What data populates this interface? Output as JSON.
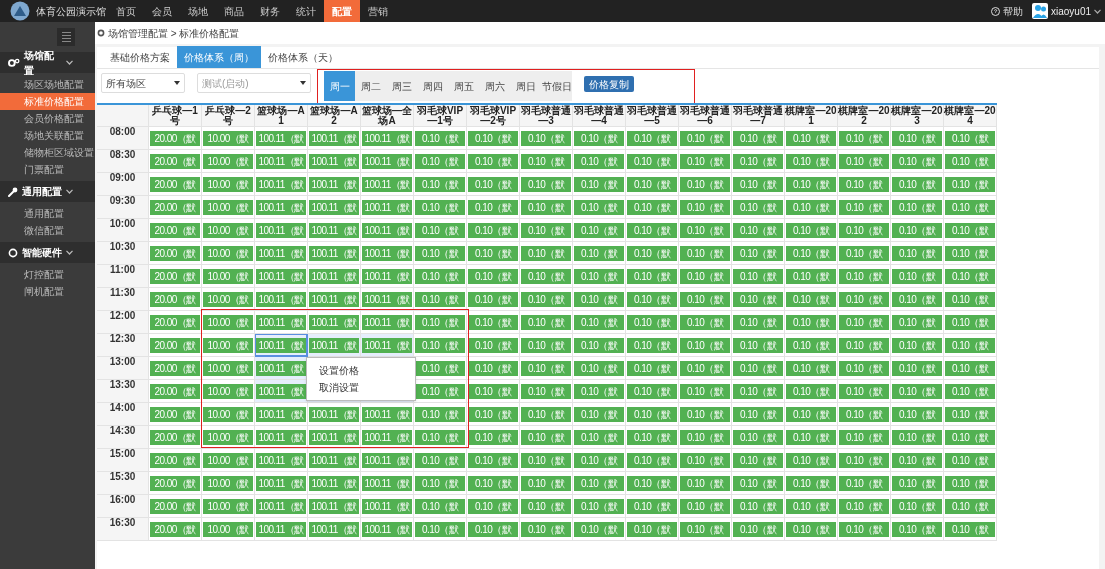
{
  "top_bar": {
    "title": "体育公园演示馆",
    "nav": [
      {
        "label": "首页",
        "selected": false
      },
      {
        "label": "会员",
        "selected": false
      },
      {
        "label": "场地",
        "selected": false
      },
      {
        "label": "商品",
        "selected": false
      },
      {
        "label": "财务",
        "selected": false
      },
      {
        "label": "统计",
        "selected": false
      },
      {
        "label": "配置",
        "selected": true
      },
      {
        "label": "营销",
        "selected": false
      }
    ],
    "help": "帮助",
    "user": "xiaoyu01"
  },
  "sidebar": {
    "groups": [
      {
        "label": "场馆配置",
        "kind": "gear",
        "expanded": true,
        "items": [
          {
            "label": "场区场地配置",
            "selected": false
          },
          {
            "label": "标准价格配置",
            "selected": true
          },
          {
            "label": "会员价格配置",
            "selected": false
          },
          {
            "label": "场地关联配置",
            "selected": false
          },
          {
            "label": "储物柜区域设置",
            "selected": false
          },
          {
            "label": "门票配置",
            "selected": false
          }
        ]
      },
      {
        "label": "通用配置",
        "kind": "wrench",
        "expanded": true,
        "items": [
          {
            "label": "通用配置",
            "selected": false
          },
          {
            "label": "微信配置",
            "selected": false
          }
        ]
      },
      {
        "label": "智能硬件",
        "kind": "ring",
        "expanded": true,
        "items": [
          {
            "label": "灯控配置",
            "selected": false
          },
          {
            "label": "闸机配置",
            "selected": false
          }
        ]
      }
    ]
  },
  "breadcrumb": "场馆管理配置 > 标准价格配置",
  "tabs": [
    {
      "label": "基础价格方案",
      "selected": false
    },
    {
      "label": "价格体系（周）",
      "selected": true
    },
    {
      "label": "价格体系（天）",
      "selected": false
    }
  ],
  "filters": [
    {
      "value": "所有场区",
      "muted": false
    },
    {
      "value": "测试(启动)",
      "muted": true
    }
  ],
  "day_tabs": [
    {
      "label": "周一",
      "selected": true
    },
    {
      "label": "周二",
      "selected": false
    },
    {
      "label": "周三",
      "selected": false
    },
    {
      "label": "周四",
      "selected": false
    },
    {
      "label": "周五",
      "selected": false
    },
    {
      "label": "周六",
      "selected": false
    },
    {
      "label": "周日",
      "selected": false
    },
    {
      "label": "节假日",
      "selected": false
    }
  ],
  "copy_button": "价格复制",
  "table": {
    "columns": [
      "乒乓球—1号",
      "乒乓球—2号",
      "篮球场—A1",
      "篮球场—A2",
      "篮球场—全场A",
      "羽毛球VIP—1号",
      "羽毛球VIP—2号",
      "羽毛球普通—3",
      "羽毛球普通—4",
      "羽毛球普通—5",
      "羽毛球普通—6",
      "羽毛球普通—7",
      "棋牌室—201",
      "棋牌室—202",
      "棋牌室—203",
      "棋牌室—204"
    ],
    "rows": [
      {
        "time": "08:00",
        "cells": [
          {
            "text": "20.00（默",
            "selected": false,
            "focused": false
          },
          {
            "text": "10.00（默",
            "selected": false,
            "focused": false
          },
          {
            "text": "100.11（默",
            "selected": false,
            "focused": false
          },
          {
            "text": "100.11（默",
            "selected": false,
            "focused": false
          },
          {
            "text": "100.11（默",
            "selected": false,
            "focused": false
          },
          {
            "text": "0.10（默",
            "selected": false,
            "focused": false
          },
          {
            "text": "0.10（默",
            "selected": false,
            "focused": false
          },
          {
            "text": "0.10（默",
            "selected": false,
            "focused": false
          },
          {
            "text": "0.10（默",
            "selected": false,
            "focused": false
          },
          {
            "text": "0.10（默",
            "selected": false,
            "focused": false
          },
          {
            "text": "0.10（默",
            "selected": false,
            "focused": false
          },
          {
            "text": "0.10（默",
            "selected": false,
            "focused": false
          },
          {
            "text": "0.10（默",
            "selected": false,
            "focused": false
          },
          {
            "text": "0.10（默",
            "selected": false,
            "focused": false
          },
          {
            "text": "0.10（默",
            "selected": false,
            "focused": false
          },
          {
            "text": "0.10（默",
            "selected": false,
            "focused": false
          }
        ]
      },
      {
        "time": "08:30",
        "cells": [
          {
            "text": "20.00（默",
            "selected": false,
            "focused": false
          },
          {
            "text": "10.00（默",
            "selected": false,
            "focused": false
          },
          {
            "text": "100.11（默",
            "selected": false,
            "focused": false
          },
          {
            "text": "100.11（默",
            "selected": false,
            "focused": false
          },
          {
            "text": "100.11（默",
            "selected": false,
            "focused": false
          },
          {
            "text": "0.10（默",
            "selected": false,
            "focused": false
          },
          {
            "text": "0.10（默",
            "selected": false,
            "focused": false
          },
          {
            "text": "0.10（默",
            "selected": false,
            "focused": false
          },
          {
            "text": "0.10（默",
            "selected": false,
            "focused": false
          },
          {
            "text": "0.10（默",
            "selected": false,
            "focused": false
          },
          {
            "text": "0.10（默",
            "selected": false,
            "focused": false
          },
          {
            "text": "0.10（默",
            "selected": false,
            "focused": false
          },
          {
            "text": "0.10（默",
            "selected": false,
            "focused": false
          },
          {
            "text": "0.10（默",
            "selected": false,
            "focused": false
          },
          {
            "text": "0.10（默",
            "selected": false,
            "focused": false
          },
          {
            "text": "0.10（默",
            "selected": false,
            "focused": false
          }
        ]
      },
      {
        "time": "09:00",
        "cells": [
          {
            "text": "20.00（默",
            "selected": false,
            "focused": false
          },
          {
            "text": "10.00（默",
            "selected": false,
            "focused": false
          },
          {
            "text": "100.11（默",
            "selected": false,
            "focused": false
          },
          {
            "text": "100.11（默",
            "selected": false,
            "focused": false
          },
          {
            "text": "100.11（默",
            "selected": false,
            "focused": false
          },
          {
            "text": "0.10（默",
            "selected": false,
            "focused": false
          },
          {
            "text": "0.10（默",
            "selected": false,
            "focused": false
          },
          {
            "text": "0.10（默",
            "selected": false,
            "focused": false
          },
          {
            "text": "0.10（默",
            "selected": false,
            "focused": false
          },
          {
            "text": "0.10（默",
            "selected": false,
            "focused": false
          },
          {
            "text": "0.10（默",
            "selected": false,
            "focused": false
          },
          {
            "text": "0.10（默",
            "selected": false,
            "focused": false
          },
          {
            "text": "0.10（默",
            "selected": false,
            "focused": false
          },
          {
            "text": "0.10（默",
            "selected": false,
            "focused": false
          },
          {
            "text": "0.10（默",
            "selected": false,
            "focused": false
          },
          {
            "text": "0.10（默",
            "selected": false,
            "focused": false
          }
        ]
      },
      {
        "time": "09:30",
        "cells": [
          {
            "text": "20.00（默",
            "selected": false,
            "focused": false
          },
          {
            "text": "10.00（默",
            "selected": false,
            "focused": false
          },
          {
            "text": "100.11（默",
            "selected": false,
            "focused": false
          },
          {
            "text": "100.11（默",
            "selected": false,
            "focused": false
          },
          {
            "text": "100.11（默",
            "selected": false,
            "focused": false
          },
          {
            "text": "0.10（默",
            "selected": false,
            "focused": false
          },
          {
            "text": "0.10（默",
            "selected": false,
            "focused": false
          },
          {
            "text": "0.10（默",
            "selected": false,
            "focused": false
          },
          {
            "text": "0.10（默",
            "selected": false,
            "focused": false
          },
          {
            "text": "0.10（默",
            "selected": false,
            "focused": false
          },
          {
            "text": "0.10（默",
            "selected": false,
            "focused": false
          },
          {
            "text": "0.10（默",
            "selected": false,
            "focused": false
          },
          {
            "text": "0.10（默",
            "selected": false,
            "focused": false
          },
          {
            "text": "0.10（默",
            "selected": false,
            "focused": false
          },
          {
            "text": "0.10（默",
            "selected": false,
            "focused": false
          },
          {
            "text": "0.10（默",
            "selected": false,
            "focused": false
          }
        ]
      },
      {
        "time": "10:00",
        "cells": [
          {
            "text": "20.00（默",
            "selected": false,
            "focused": false
          },
          {
            "text": "10.00（默",
            "selected": false,
            "focused": false
          },
          {
            "text": "100.11（默",
            "selected": false,
            "focused": false
          },
          {
            "text": "100.11（默",
            "selected": false,
            "focused": false
          },
          {
            "text": "100.11（默",
            "selected": false,
            "focused": false
          },
          {
            "text": "0.10（默",
            "selected": false,
            "focused": false
          },
          {
            "text": "0.10（默",
            "selected": false,
            "focused": false
          },
          {
            "text": "0.10（默",
            "selected": false,
            "focused": false
          },
          {
            "text": "0.10（默",
            "selected": false,
            "focused": false
          },
          {
            "text": "0.10（默",
            "selected": false,
            "focused": false
          },
          {
            "text": "0.10（默",
            "selected": false,
            "focused": false
          },
          {
            "text": "0.10（默",
            "selected": false,
            "focused": false
          },
          {
            "text": "0.10（默",
            "selected": false,
            "focused": false
          },
          {
            "text": "0.10（默",
            "selected": false,
            "focused": false
          },
          {
            "text": "0.10（默",
            "selected": false,
            "focused": false
          },
          {
            "text": "0.10（默",
            "selected": false,
            "focused": false
          }
        ]
      },
      {
        "time": "10:30",
        "cells": [
          {
            "text": "20.00（默",
            "selected": false,
            "focused": false
          },
          {
            "text": "10.00（默",
            "selected": false,
            "focused": false
          },
          {
            "text": "100.11（默",
            "selected": false,
            "focused": false
          },
          {
            "text": "100.11（默",
            "selected": false,
            "focused": false
          },
          {
            "text": "100.11（默",
            "selected": false,
            "focused": false
          },
          {
            "text": "0.10（默",
            "selected": false,
            "focused": false
          },
          {
            "text": "0.10（默",
            "selected": false,
            "focused": false
          },
          {
            "text": "0.10（默",
            "selected": false,
            "focused": false
          },
          {
            "text": "0.10（默",
            "selected": false,
            "focused": false
          },
          {
            "text": "0.10（默",
            "selected": false,
            "focused": false
          },
          {
            "text": "0.10（默",
            "selected": false,
            "focused": false
          },
          {
            "text": "0.10（默",
            "selected": false,
            "focused": false
          },
          {
            "text": "0.10（默",
            "selected": false,
            "focused": false
          },
          {
            "text": "0.10（默",
            "selected": false,
            "focused": false
          },
          {
            "text": "0.10（默",
            "selected": false,
            "focused": false
          },
          {
            "text": "0.10（默",
            "selected": false,
            "focused": false
          }
        ]
      },
      {
        "time": "11:00",
        "cells": [
          {
            "text": "20.00（默",
            "selected": false,
            "focused": false
          },
          {
            "text": "10.00（默",
            "selected": false,
            "focused": false
          },
          {
            "text": "100.11（默",
            "selected": false,
            "focused": false
          },
          {
            "text": "100.11（默",
            "selected": false,
            "focused": false
          },
          {
            "text": "100.11（默",
            "selected": false,
            "focused": false
          },
          {
            "text": "0.10（默",
            "selected": false,
            "focused": false
          },
          {
            "text": "0.10（默",
            "selected": false,
            "focused": false
          },
          {
            "text": "0.10（默",
            "selected": false,
            "focused": false
          },
          {
            "text": "0.10（默",
            "selected": false,
            "focused": false
          },
          {
            "text": "0.10（默",
            "selected": false,
            "focused": false
          },
          {
            "text": "0.10（默",
            "selected": false,
            "focused": false
          },
          {
            "text": "0.10（默",
            "selected": false,
            "focused": false
          },
          {
            "text": "0.10（默",
            "selected": false,
            "focused": false
          },
          {
            "text": "0.10（默",
            "selected": false,
            "focused": false
          },
          {
            "text": "0.10（默",
            "selected": false,
            "focused": false
          },
          {
            "text": "0.10（默",
            "selected": false,
            "focused": false
          }
        ]
      },
      {
        "time": "11:30",
        "cells": [
          {
            "text": "20.00（默",
            "selected": false,
            "focused": false
          },
          {
            "text": "10.00（默",
            "selected": false,
            "focused": false
          },
          {
            "text": "100.11（默",
            "selected": false,
            "focused": false
          },
          {
            "text": "100.11（默",
            "selected": false,
            "focused": false
          },
          {
            "text": "100.11（默",
            "selected": false,
            "focused": false
          },
          {
            "text": "0.10（默",
            "selected": false,
            "focused": false
          },
          {
            "text": "0.10（默",
            "selected": false,
            "focused": false
          },
          {
            "text": "0.10（默",
            "selected": false,
            "focused": false
          },
          {
            "text": "0.10（默",
            "selected": false,
            "focused": false
          },
          {
            "text": "0.10（默",
            "selected": false,
            "focused": false
          },
          {
            "text": "0.10（默",
            "selected": false,
            "focused": false
          },
          {
            "text": "0.10（默",
            "selected": false,
            "focused": false
          },
          {
            "text": "0.10（默",
            "selected": false,
            "focused": false
          },
          {
            "text": "0.10（默",
            "selected": false,
            "focused": false
          },
          {
            "text": "0.10（默",
            "selected": false,
            "focused": false
          },
          {
            "text": "0.10（默",
            "selected": false,
            "focused": false
          }
        ]
      },
      {
        "time": "12:00",
        "cells": [
          {
            "text": "20.00（默",
            "selected": false,
            "focused": false
          },
          {
            "text": "10.00（默",
            "selected": false,
            "focused": false
          },
          {
            "text": "100.11（默",
            "selected": false,
            "focused": false
          },
          {
            "text": "100.11（默",
            "selected": false,
            "focused": false
          },
          {
            "text": "100.11（默",
            "selected": false,
            "focused": false
          },
          {
            "text": "0.10（默",
            "selected": false,
            "focused": false
          },
          {
            "text": "0.10（默",
            "selected": false,
            "focused": false
          },
          {
            "text": "0.10（默",
            "selected": false,
            "focused": false
          },
          {
            "text": "0.10（默",
            "selected": false,
            "focused": false
          },
          {
            "text": "0.10（默",
            "selected": false,
            "focused": false
          },
          {
            "text": "0.10（默",
            "selected": false,
            "focused": false
          },
          {
            "text": "0.10（默",
            "selected": false,
            "focused": false
          },
          {
            "text": "0.10（默",
            "selected": false,
            "focused": false
          },
          {
            "text": "0.10（默",
            "selected": false,
            "focused": false
          },
          {
            "text": "0.10（默",
            "selected": false,
            "focused": false
          },
          {
            "text": "0.10（默",
            "selected": false,
            "focused": false
          }
        ]
      },
      {
        "time": "12:30",
        "cells": [
          {
            "text": "20.00（默",
            "selected": false,
            "focused": false
          },
          {
            "text": "10.00（默",
            "selected": false,
            "focused": false
          },
          {
            "text": "100.11（默",
            "selected": true,
            "focused": true
          },
          {
            "text": "100.11（默",
            "selected": true,
            "focused": false
          },
          {
            "text": "100.11（默",
            "selected": true,
            "focused": false
          },
          {
            "text": "0.10（默",
            "selected": false,
            "focused": false
          },
          {
            "text": "0.10（默",
            "selected": false,
            "focused": false
          },
          {
            "text": "0.10（默",
            "selected": false,
            "focused": false
          },
          {
            "text": "0.10（默",
            "selected": false,
            "focused": false
          },
          {
            "text": "0.10（默",
            "selected": false,
            "focused": false
          },
          {
            "text": "0.10（默",
            "selected": false,
            "focused": false
          },
          {
            "text": "0.10（默",
            "selected": false,
            "focused": false
          },
          {
            "text": "0.10（默",
            "selected": false,
            "focused": false
          },
          {
            "text": "0.10（默",
            "selected": false,
            "focused": false
          },
          {
            "text": "0.10（默",
            "selected": false,
            "focused": false
          },
          {
            "text": "0.10（默",
            "selected": false,
            "focused": false
          }
        ]
      },
      {
        "time": "13:00",
        "cells": [
          {
            "text": "20.00（默",
            "selected": false,
            "focused": false
          },
          {
            "text": "10.00（默",
            "selected": false,
            "focused": false
          },
          {
            "text": "100.11（默",
            "selected": true,
            "focused": false
          },
          {},
          {},
          {
            "text": "0.10（默",
            "selected": false,
            "focused": false
          },
          {
            "text": "0.10（默",
            "selected": false,
            "focused": false
          },
          {
            "text": "0.10（默",
            "selected": false,
            "focused": false
          },
          {
            "text": "0.10（默",
            "selected": false,
            "focused": false
          },
          {
            "text": "0.10（默",
            "selected": false,
            "focused": false
          },
          {
            "text": "0.10（默",
            "selected": false,
            "focused": false
          },
          {
            "text": "0.10（默",
            "selected": false,
            "focused": false
          },
          {
            "text": "0.10（默",
            "selected": false,
            "focused": false
          },
          {
            "text": "0.10（默",
            "selected": false,
            "focused": false
          },
          {
            "text": "0.10（默",
            "selected": false,
            "focused": false
          },
          {
            "text": "0.10（默",
            "selected": false,
            "focused": false
          }
        ]
      },
      {
        "time": "13:30",
        "cells": [
          {
            "text": "20.00（默",
            "selected": false,
            "focused": false
          },
          {
            "text": "10.00（默",
            "selected": false,
            "focused": false
          },
          {
            "text": "100.11（默",
            "selected": true,
            "focused": false
          },
          {
            "selected": true,
            "focused": false
          },
          {
            "selected": true,
            "focused": false
          },
          {
            "text": "0.10（默",
            "selected": false,
            "focused": false
          },
          {
            "text": "0.10（默",
            "selected": false,
            "focused": false
          },
          {
            "text": "0.10（默",
            "selected": false,
            "focused": false
          },
          {
            "text": "0.10（默",
            "selected": false,
            "focused": false
          },
          {
            "text": "0.10（默",
            "selected": false,
            "focused": false
          },
          {
            "text": "0.10（默",
            "selected": false,
            "focused": false
          },
          {
            "text": "0.10（默",
            "selected": false,
            "focused": false
          },
          {
            "text": "0.10（默",
            "selected": false,
            "focused": false
          },
          {
            "text": "0.10（默",
            "selected": false,
            "focused": false
          },
          {
            "text": "0.10（默",
            "selected": false,
            "focused": false
          },
          {
            "text": "0.10（默",
            "selected": false,
            "focused": false
          }
        ]
      },
      {
        "time": "14:00",
        "cells": [
          {
            "text": "20.00（默",
            "selected": false,
            "focused": false
          },
          {
            "text": "10.00（默",
            "selected": false,
            "focused": false
          },
          {
            "text": "100.11（默",
            "selected": false,
            "focused": false
          },
          {
            "text": "100.11（默",
            "selected": false,
            "focused": false
          },
          {
            "text": "100.11（默",
            "selected": false,
            "focused": false
          },
          {
            "text": "0.10（默",
            "selected": false,
            "focused": false
          },
          {
            "text": "0.10（默",
            "selected": false,
            "focused": false
          },
          {
            "text": "0.10（默",
            "selected": false,
            "focused": false
          },
          {
            "text": "0.10（默",
            "selected": false,
            "focused": false
          },
          {
            "text": "0.10（默",
            "selected": false,
            "focused": false
          },
          {
            "text": "0.10（默",
            "selected": false,
            "focused": false
          },
          {
            "text": "0.10（默",
            "selected": false,
            "focused": false
          },
          {
            "text": "0.10（默",
            "selected": false,
            "focused": false
          },
          {
            "text": "0.10（默",
            "selected": false,
            "focused": false
          },
          {
            "text": "0.10（默",
            "selected": false,
            "focused": false
          },
          {
            "text": "0.10（默",
            "selected": false,
            "focused": false
          }
        ]
      },
      {
        "time": "14:30",
        "cells": [
          {
            "text": "20.00（默",
            "selected": false,
            "focused": false
          },
          {
            "text": "10.00（默",
            "selected": false,
            "focused": false
          },
          {
            "text": "100.11（默",
            "selected": false,
            "focused": false
          },
          {
            "text": "100.11（默",
            "selected": false,
            "focused": false
          },
          {
            "text": "100.11（默",
            "selected": false,
            "focused": false
          },
          {
            "text": "0.10（默",
            "selected": false,
            "focused": false
          },
          {
            "text": "0.10（默",
            "selected": false,
            "focused": false
          },
          {
            "text": "0.10（默",
            "selected": false,
            "focused": false
          },
          {
            "text": "0.10（默",
            "selected": false,
            "focused": false
          },
          {
            "text": "0.10（默",
            "selected": false,
            "focused": false
          },
          {
            "text": "0.10（默",
            "selected": false,
            "focused": false
          },
          {
            "text": "0.10（默",
            "selected": false,
            "focused": false
          },
          {
            "text": "0.10（默",
            "selected": false,
            "focused": false
          },
          {
            "text": "0.10（默",
            "selected": false,
            "focused": false
          },
          {
            "text": "0.10（默",
            "selected": false,
            "focused": false
          },
          {
            "text": "0.10（默",
            "selected": false,
            "focused": false
          }
        ]
      },
      {
        "time": "15:00",
        "cells": [
          {
            "text": "20.00（默",
            "selected": false,
            "focused": false
          },
          {
            "text": "10.00（默",
            "selected": false,
            "focused": false
          },
          {
            "text": "100.11（默",
            "selected": false,
            "focused": false
          },
          {
            "text": "100.11（默",
            "selected": false,
            "focused": false
          },
          {
            "text": "100.11（默",
            "selected": false,
            "focused": false
          },
          {
            "text": "0.10（默",
            "selected": false,
            "focused": false
          },
          {
            "text": "0.10（默",
            "selected": false,
            "focused": false
          },
          {
            "text": "0.10（默",
            "selected": false,
            "focused": false
          },
          {
            "text": "0.10（默",
            "selected": false,
            "focused": false
          },
          {
            "text": "0.10（默",
            "selected": false,
            "focused": false
          },
          {
            "text": "0.10（默",
            "selected": false,
            "focused": false
          },
          {
            "text": "0.10（默",
            "selected": false,
            "focused": false
          },
          {
            "text": "0.10（默",
            "selected": false,
            "focused": false
          },
          {
            "text": "0.10（默",
            "selected": false,
            "focused": false
          },
          {
            "text": "0.10（默",
            "selected": false,
            "focused": false
          },
          {
            "text": "0.10（默",
            "selected": false,
            "focused": false
          }
        ]
      },
      {
        "time": "15:30",
        "cells": [
          {
            "text": "20.00（默",
            "selected": false,
            "focused": false
          },
          {
            "text": "10.00（默",
            "selected": false,
            "focused": false
          },
          {
            "text": "100.11（默",
            "selected": false,
            "focused": false
          },
          {
            "text": "100.11（默",
            "selected": false,
            "focused": false
          },
          {
            "text": "100.11（默",
            "selected": false,
            "focused": false
          },
          {
            "text": "0.10（默",
            "selected": false,
            "focused": false
          },
          {
            "text": "0.10（默",
            "selected": false,
            "focused": false
          },
          {
            "text": "0.10（默",
            "selected": false,
            "focused": false
          },
          {
            "text": "0.10（默",
            "selected": false,
            "focused": false
          },
          {
            "text": "0.10（默",
            "selected": false,
            "focused": false
          },
          {
            "text": "0.10（默",
            "selected": false,
            "focused": false
          },
          {
            "text": "0.10（默",
            "selected": false,
            "focused": false
          },
          {
            "text": "0.10（默",
            "selected": false,
            "focused": false
          },
          {
            "text": "0.10（默",
            "selected": false,
            "focused": false
          },
          {
            "text": "0.10（默",
            "selected": false,
            "focused": false
          },
          {
            "text": "0.10（默",
            "selected": false,
            "focused": false
          }
        ]
      },
      {
        "time": "16:00",
        "cells": [
          {
            "text": "20.00（默",
            "selected": false,
            "focused": false
          },
          {
            "text": "10.00（默",
            "selected": false,
            "focused": false
          },
          {
            "text": "100.11（默",
            "selected": false,
            "focused": false
          },
          {
            "text": "100.11（默",
            "selected": false,
            "focused": false
          },
          {
            "text": "100.11（默",
            "selected": false,
            "focused": false
          },
          {
            "text": "0.10（默",
            "selected": false,
            "focused": false
          },
          {
            "text": "0.10（默",
            "selected": false,
            "focused": false
          },
          {
            "text": "0.10（默",
            "selected": false,
            "focused": false
          },
          {
            "text": "0.10（默",
            "selected": false,
            "focused": false
          },
          {
            "text": "0.10（默",
            "selected": false,
            "focused": false
          },
          {
            "text": "0.10（默",
            "selected": false,
            "focused": false
          },
          {
            "text": "0.10（默",
            "selected": false,
            "focused": false
          },
          {
            "text": "0.10（默",
            "selected": false,
            "focused": false
          },
          {
            "text": "0.10（默",
            "selected": false,
            "focused": false
          },
          {
            "text": "0.10（默",
            "selected": false,
            "focused": false
          },
          {
            "text": "0.10（默",
            "selected": false,
            "focused": false
          }
        ]
      },
      {
        "time": "16:30",
        "cells": [
          {
            "text": "20.00（默",
            "selected": false,
            "focused": false
          },
          {
            "text": "10.00（默",
            "selected": false,
            "focused": false
          },
          {
            "text": "100.11（默",
            "selected": false,
            "focused": false
          },
          {
            "text": "100.11（默",
            "selected": false,
            "focused": false
          },
          {
            "text": "100.11（默",
            "selected": false,
            "focused": false
          },
          {
            "text": "0.10（默",
            "selected": false,
            "focused": false
          },
          {
            "text": "0.10（默",
            "selected": false,
            "focused": false
          },
          {
            "text": "0.10（默",
            "selected": false,
            "focused": false
          },
          {
            "text": "0.10（默",
            "selected": false,
            "focused": false
          },
          {
            "text": "0.10（默",
            "selected": false,
            "focused": false
          },
          {
            "text": "0.10（默",
            "selected": false,
            "focused": false
          },
          {
            "text": "0.10（默",
            "selected": false,
            "focused": false
          },
          {
            "text": "0.10（默",
            "selected": false,
            "focused": false
          },
          {
            "text": "0.10（默",
            "selected": false,
            "focused": false
          },
          {
            "text": "0.10（默",
            "selected": false,
            "focused": false
          },
          {
            "text": "0.10（默",
            "selected": false,
            "focused": false
          }
        ]
      }
    ]
  },
  "context_menu": [
    "设置价格",
    "取消设置"
  ]
}
